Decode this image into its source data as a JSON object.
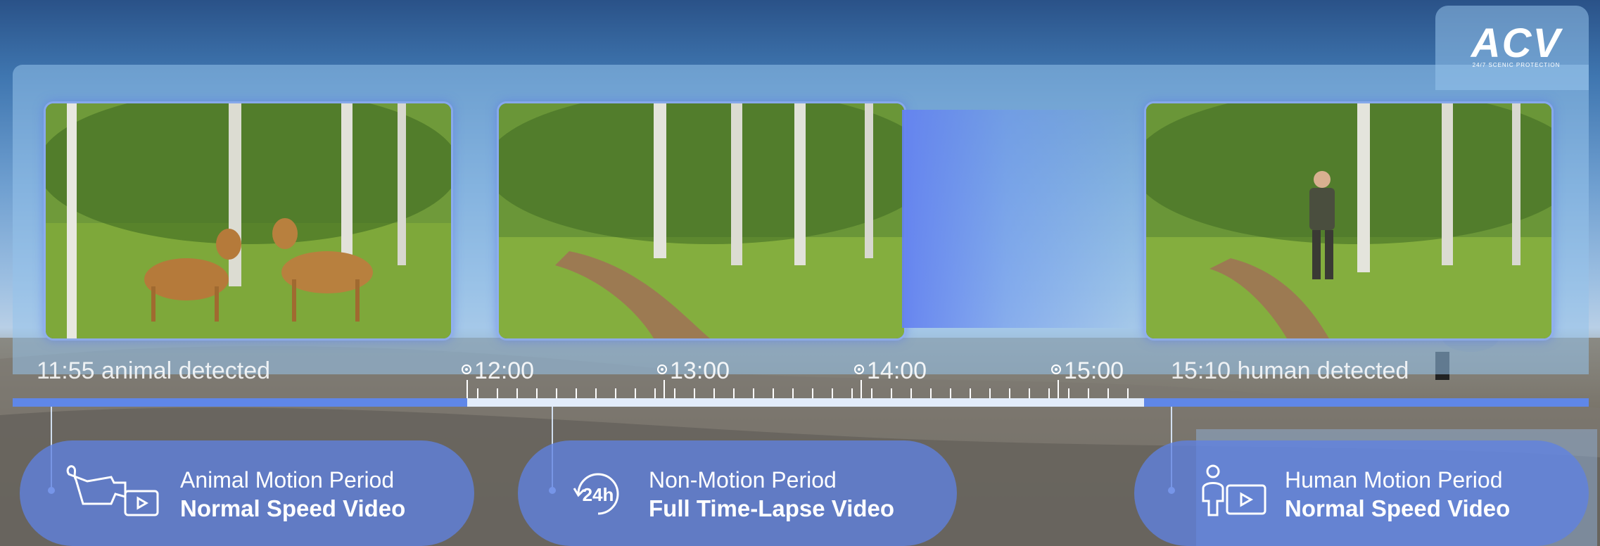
{
  "brand": {
    "logo": "ACV",
    "tagline": "24/7 SCENIC PROTECTION"
  },
  "events": {
    "left": "11:55 animal detected",
    "right": "15:10 human detected"
  },
  "timeline": {
    "ticks": [
      "12:00",
      "13:00",
      "14:00",
      "15:00"
    ]
  },
  "periods": [
    {
      "title": "Animal Motion Period",
      "subtitle": "Normal Speed Video",
      "icon": "cat-video-icon"
    },
    {
      "title": "Non-Motion Period",
      "subtitle": "Full Time-Lapse Video",
      "icon": "24h-icon"
    },
    {
      "title": "Human Motion Period",
      "subtitle": "Normal Speed Video",
      "icon": "person-video-icon"
    }
  ],
  "colors": {
    "accent": "#5f87e8",
    "pill": "#5f82e1",
    "text": "#ffffff"
  }
}
